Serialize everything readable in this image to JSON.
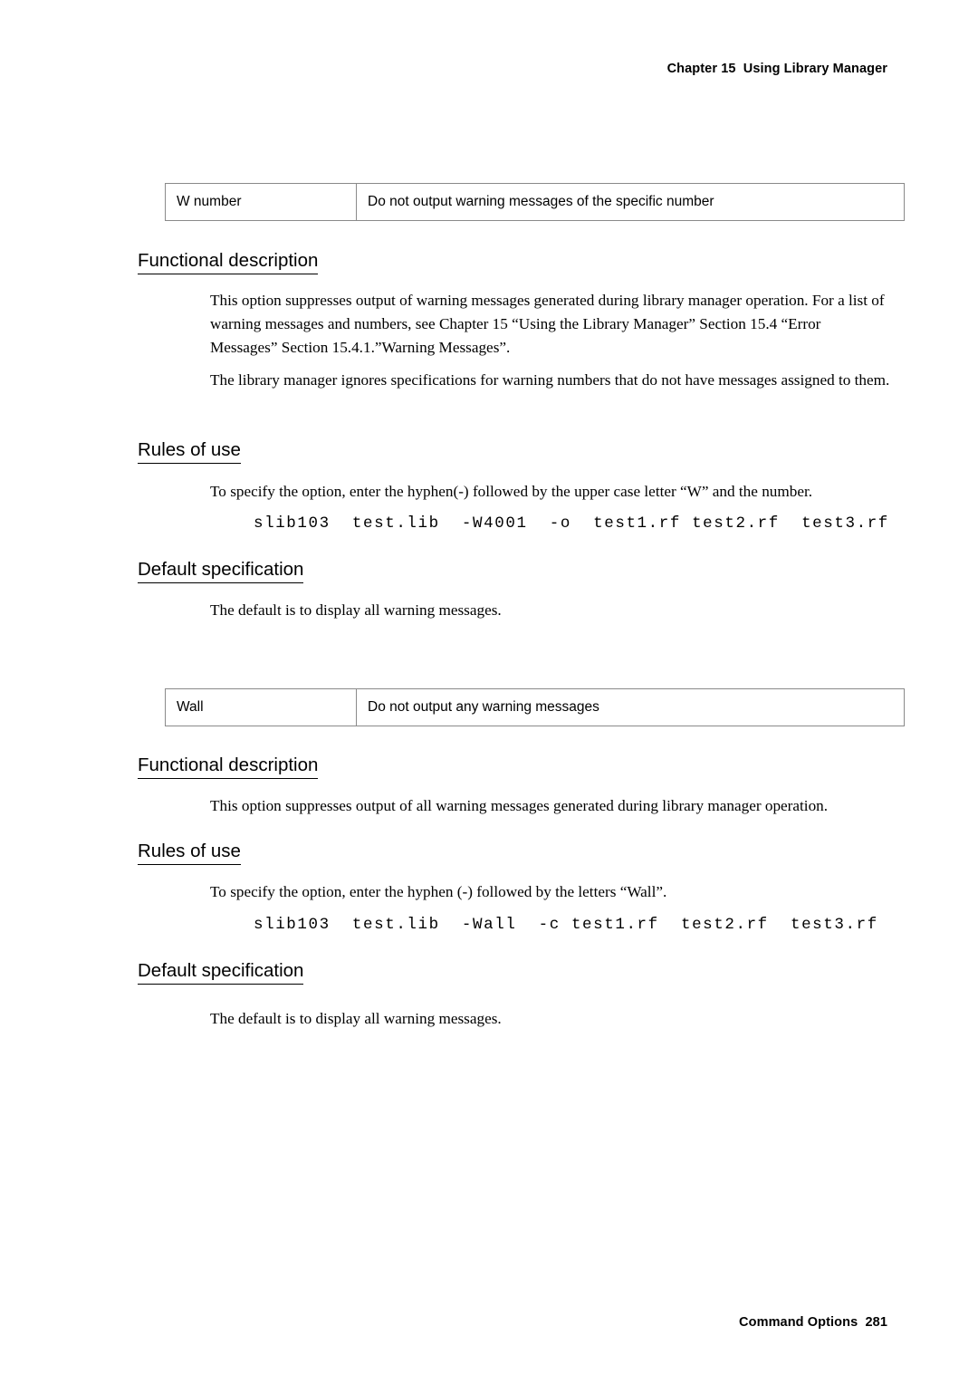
{
  "header": {
    "running_head": "Chapter 15  Using Library Manager"
  },
  "footer": {
    "running_foot": "Command Options  281"
  },
  "sections": [
    {
      "table": {
        "option": "W number",
        "description": "Do not output warning messages of the specific number"
      },
      "functional_description": {
        "heading": "Functional description",
        "paragraphs": [
          "This option suppresses output of warning messages generated during library manager operation.  For a list of warning messages and numbers, see Chapter 15 “Using the Library Manager” Section 15.4 “Error Messages” Section 15.4.1.”Warning Messages”.",
          "The library manager ignores specifications for warning numbers that do not have messages assigned to them."
        ]
      },
      "rules_of_use": {
        "heading": "Rules of use",
        "paragraph": "To specify the option, enter the hyphen(-) followed by the upper case letter “W” and the number.",
        "command": "slib103  test.lib  -W4001  -o  test1.rf test2.rf  test3.rf"
      },
      "default_specification": {
        "heading": "Default specification",
        "paragraph": "The default is to display all warning messages."
      }
    },
    {
      "table": {
        "option": "Wall",
        "description": "Do not output any warning messages"
      },
      "functional_description": {
        "heading": "Functional description",
        "paragraphs": [
          "This option suppresses output of all warning messages generated during library manager operation."
        ]
      },
      "rules_of_use": {
        "heading": "Rules of use",
        "paragraph": "To specify the option, enter the hyphen (-) followed by the letters “Wall”.",
        "command": "slib103  test.lib  -Wall  -c test1.rf  test2.rf  test3.rf"
      },
      "default_specification": {
        "heading": "Default specification",
        "paragraph": "The default is to display all warning messages."
      }
    }
  ]
}
